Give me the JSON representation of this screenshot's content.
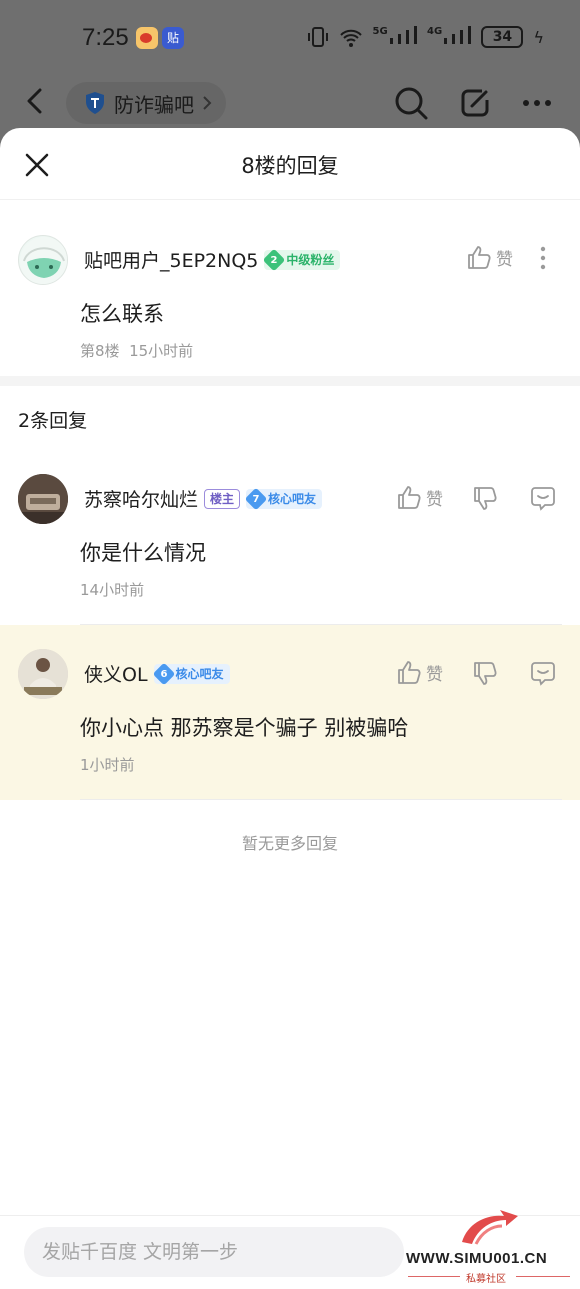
{
  "status_bar": {
    "time": "7:25",
    "network_a": "5G",
    "network_b": "4G",
    "battery": "34",
    "icons": [
      "weibo-icon",
      "tieba-icon",
      "vibrate-icon",
      "wifi-icon",
      "signal-icon",
      "battery-icon",
      "charging-icon"
    ]
  },
  "top_bar": {
    "forum_name": "防诈骗吧",
    "icons": [
      "back-icon",
      "shield-icon",
      "chevron-right-icon",
      "search-icon",
      "edit-icon",
      "more-icon"
    ]
  },
  "sheet": {
    "title": "8楼的回复"
  },
  "main_post": {
    "author": "贴吧用户_5EP2NQ5",
    "badge_level": "2",
    "badge_label": "中级粉丝",
    "content": "怎么联系",
    "floor": "第8楼",
    "time": "15小时前",
    "like_label": "赞"
  },
  "replies_count": "2条回复",
  "replies": [
    {
      "author": "苏察哈尔灿烂",
      "host_tag": "楼主",
      "badge_level": "7",
      "badge_label": "核心吧友",
      "content": "你是什么情况",
      "time": "14小时前",
      "like_label": "赞"
    },
    {
      "author": "侠义OL",
      "badge_level": "6",
      "badge_label": "核心吧友",
      "content": "你小心点 那苏察是个骗子 别被骗哈",
      "time": "1小时前",
      "like_label": "赞"
    }
  ],
  "no_more": "暂无更多回复",
  "composer": {
    "placeholder": "发贴千百度 文明第一步"
  },
  "watermark": {
    "text": "WWW.SIMU001.CN",
    "subtext": "私募社区"
  },
  "colors": {
    "highlight_bg": "#fbf7e4",
    "badge_green": "#3cc27a",
    "badge_blue": "#4a9af0",
    "host_tag": "#6f5fc4"
  }
}
